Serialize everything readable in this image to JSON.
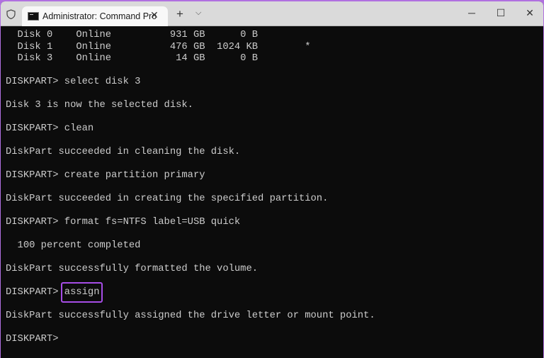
{
  "window": {
    "tab_title": "Administrator: Command Pro",
    "icons": {
      "shield": "shield-icon",
      "terminal": "terminal-icon",
      "close_tab": "close-icon",
      "new_tab": "plus-icon",
      "dropdown": "chevron-down-icon"
    },
    "controls": {
      "minimize": "─",
      "maximize": "☐",
      "close": "✕"
    },
    "new_tab": "+",
    "dropdown": "⌵",
    "tab_close": "✕"
  },
  "terminal": {
    "lines": [
      "  Disk 0    Online          931 GB      0 B",
      "  Disk 1    Online          476 GB  1024 KB        *",
      "  Disk 3    Online           14 GB      0 B",
      "",
      "DISKPART> select disk 3",
      "",
      "Disk 3 is now the selected disk.",
      "",
      "DISKPART> clean",
      "",
      "DiskPart succeeded in cleaning the disk.",
      "",
      "DISKPART> create partition primary",
      "",
      "DiskPart succeeded in creating the specified partition.",
      "",
      "DISKPART> format fs=NTFS label=USB quick",
      "",
      "  100 percent completed",
      "",
      "DiskPart successfully formatted the volume.",
      "",
      "DISKPART> ",
      "",
      "DiskPart successfully assigned the drive letter or mount point.",
      "",
      "DISKPART> "
    ],
    "highlighted_command": "assign",
    "highlight_color": "#a64de6"
  }
}
